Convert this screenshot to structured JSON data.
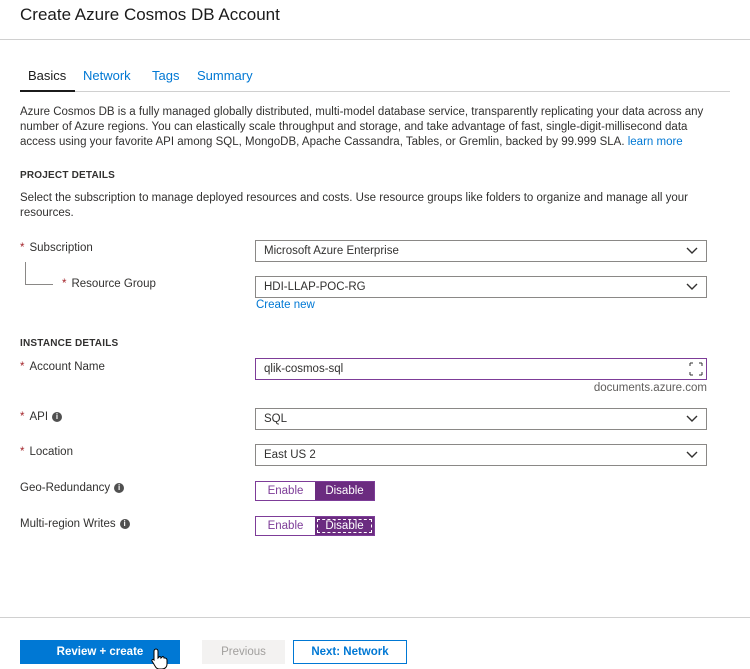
{
  "header": {
    "title": "Create Azure Cosmos DB Account"
  },
  "tabs": [
    {
      "label": "Basics",
      "active": true
    },
    {
      "label": "Network",
      "active": false
    },
    {
      "label": "Tags",
      "active": false
    },
    {
      "label": "Summary",
      "active": false
    }
  ],
  "description": {
    "text": "Azure Cosmos DB is a fully managed globally distributed, multi-model database service, transparently replicating your data across any number of Azure regions. You can elastically scale throughput and storage, and take advantage of fast, single-digit-millisecond data access using your favorite API among SQL, MongoDB, Apache Cassandra, Tables, or Gremlin, backed by 99.999 SLA.",
    "link": "learn more"
  },
  "project_details": {
    "title": "PROJECT DETAILS",
    "description": "Select the subscription to manage deployed resources and costs. Use resource groups like folders to organize and manage all your resources.",
    "subscription": {
      "label": "Subscription",
      "value": "Microsoft Azure Enterprise"
    },
    "resource_group": {
      "label": "Resource Group",
      "value": "HDI-LLAP-POC-RG",
      "create_new": "Create new"
    }
  },
  "instance_details": {
    "title": "INSTANCE DETAILS",
    "account_name": {
      "label": "Account Name",
      "value": "qlik-cosmos-sql",
      "suffix": "documents.azure.com"
    },
    "api": {
      "label": "API",
      "value": "SQL"
    },
    "location": {
      "label": "Location",
      "value": "East US 2"
    },
    "geo_redundancy": {
      "label": "Geo-Redundancy",
      "enable": "Enable",
      "disable": "Disable",
      "selected": "Disable"
    },
    "multi_region_writes": {
      "label": "Multi-region Writes",
      "enable": "Enable",
      "disable": "Disable",
      "selected": "Disable"
    }
  },
  "footer": {
    "review_create": "Review + create",
    "previous": "Previous",
    "next": "Next: Network"
  },
  "colors": {
    "accent": "#0078d4",
    "toggle_selected": "#6b2c80",
    "required": "#a4262c"
  }
}
